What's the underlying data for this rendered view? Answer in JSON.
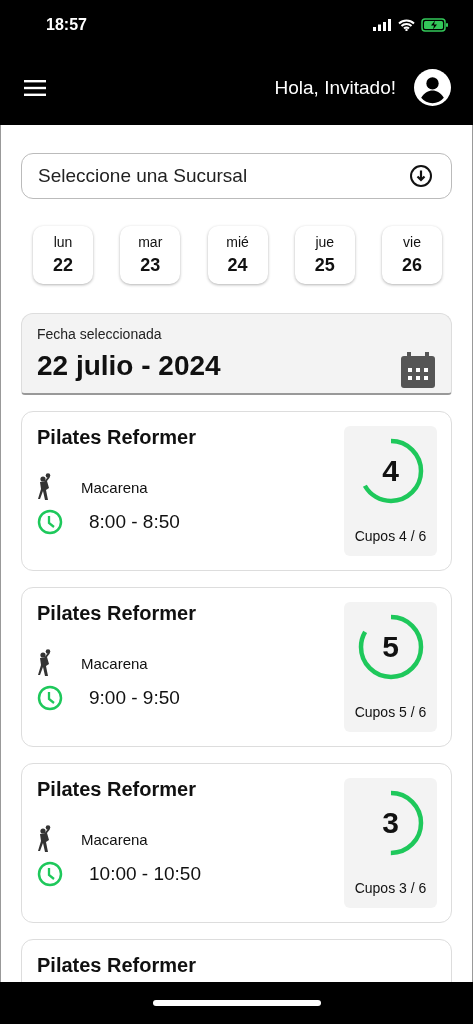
{
  "status_bar": {
    "time": "18:57"
  },
  "header": {
    "greeting": "Hola, Invitado!"
  },
  "branch_select": {
    "placeholder": "Seleccione una Sucursal"
  },
  "days": [
    {
      "weekday": "lun",
      "day": "22"
    },
    {
      "weekday": "mar",
      "day": "23"
    },
    {
      "weekday": "mié",
      "day": "24"
    },
    {
      "weekday": "jue",
      "day": "25"
    },
    {
      "weekday": "vie",
      "day": "26"
    }
  ],
  "selected_date": {
    "label": "Fecha seleccionada",
    "value": "22 julio - 2024"
  },
  "classes": [
    {
      "title": "Pilates Reformer",
      "instructor": "Macarena",
      "time": "8:00 - 8:50",
      "count": "4",
      "capacity": "Cupos 4 / 6",
      "level": 0.667
    },
    {
      "title": "Pilates Reformer",
      "instructor": "Macarena",
      "time": "9:00 - 9:50",
      "count": "5",
      "capacity": "Cupos 5 / 6",
      "level": 0.833
    },
    {
      "title": "Pilates Reformer",
      "instructor": "Macarena",
      "time": "10:00 - 10:50",
      "count": "3",
      "capacity": "Cupos 3 / 6",
      "level": 0.5
    },
    {
      "title": "Pilates Reformer"
    }
  ]
}
